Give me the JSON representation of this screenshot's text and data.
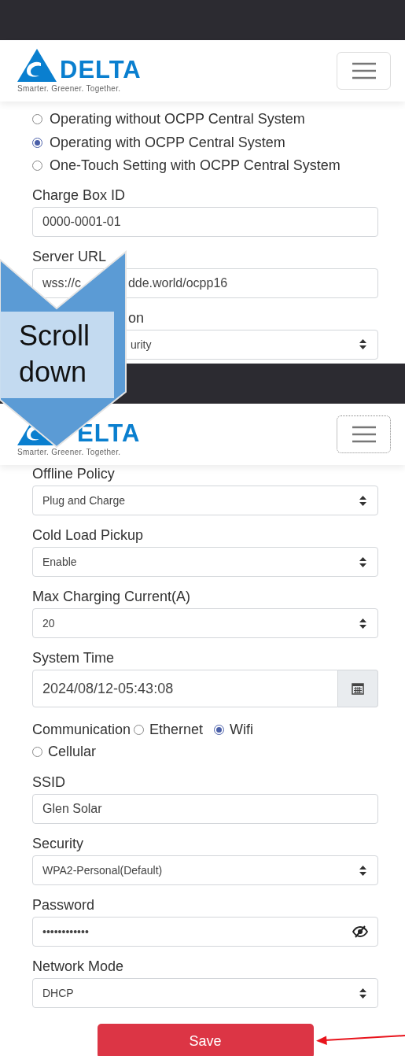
{
  "screens": [
    {
      "kind": "top",
      "header": {
        "wordmark": "DELTA",
        "tagline": "Smarter. Greener. Together.",
        "menu_focused": false
      },
      "items": [
        {
          "kind": "radio-group",
          "options": [
            {
              "label": "Operating without OCPP Central System",
              "selected": false
            },
            {
              "label": "Operating with OCPP Central System",
              "selected": true
            },
            {
              "label": "One-Touch Setting with OCPP Central System",
              "selected": false
            }
          ]
        },
        {
          "kind": "input",
          "label": "Charge Box ID",
          "value": "0000-0001-01"
        },
        {
          "kind": "split-input",
          "label": "Server URL",
          "value_parts": [
            "wss://c",
            "dde.world/ocpp16"
          ]
        },
        {
          "kind": "covered-select",
          "label": "on",
          "value": "urity"
        }
      ]
    },
    {
      "kind": "scrolled",
      "header": {
        "wordmark": "ELTA",
        "tagline": "Smarter. Greener. Together.",
        "menu_focused": true
      },
      "items": [
        {
          "kind": "select",
          "label": "Offline Policy",
          "value": "Plug and Charge"
        },
        {
          "kind": "select",
          "label": "Cold Load Pickup",
          "value": "Enable"
        },
        {
          "kind": "select",
          "label": "Max Charging Current(A)",
          "value": "20"
        },
        {
          "kind": "date",
          "label": "System Time",
          "value": "2024/08/12-05:43:08"
        },
        {
          "kind": "inline-radios",
          "label": "Communication",
          "options": [
            {
              "label": "Ethernet",
              "selected": false
            },
            {
              "label": "Wifi",
              "selected": true
            },
            {
              "label": "Cellular",
              "selected": false
            }
          ]
        },
        {
          "kind": "input",
          "label": "SSID",
          "value": "Glen Solar"
        },
        {
          "kind": "select",
          "label": "Security",
          "value": "WPA2-Personal(Default)"
        },
        {
          "kind": "password",
          "label": "Password",
          "value": "••••••••••••"
        },
        {
          "kind": "select",
          "label": "Network Mode",
          "value": "DHCP"
        },
        {
          "kind": "button",
          "label": "Save"
        }
      ]
    }
  ],
  "overlay": {
    "label": "Scroll down"
  }
}
